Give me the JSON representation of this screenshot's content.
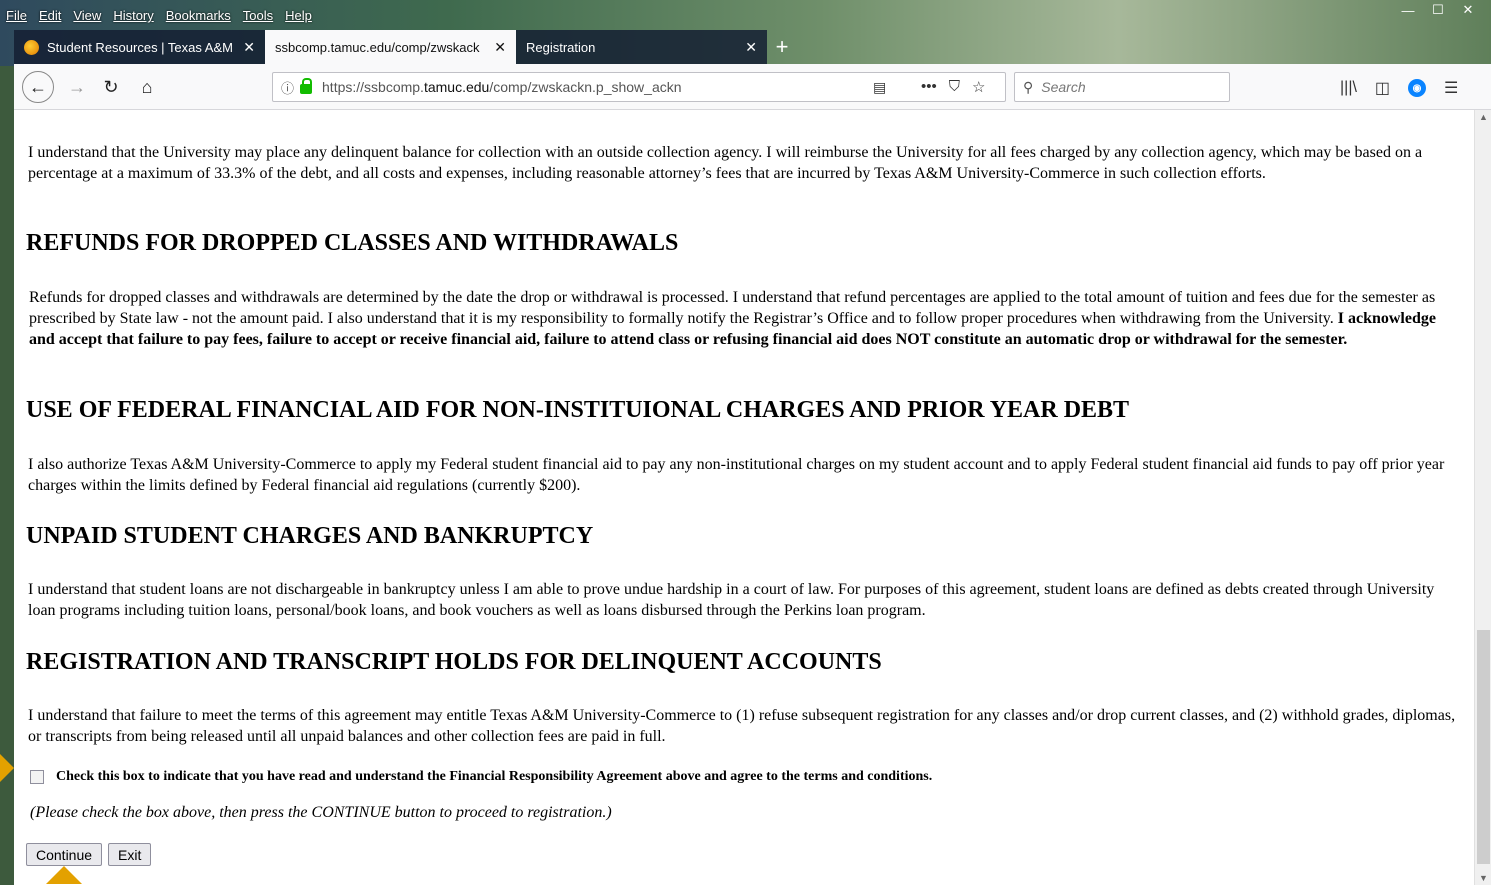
{
  "browser": {
    "menu": [
      "File",
      "Edit",
      "View",
      "History",
      "Bookmarks",
      "Tools",
      "Help"
    ],
    "window_controls": {
      "minimize": "—",
      "maximize": "☐",
      "close": "✕"
    },
    "tabs": [
      {
        "title": "Student Resources | Texas A&M",
        "close": "✕"
      },
      {
        "title": "ssbcomp.tamuc.edu/comp/zwskack",
        "close": "✕"
      },
      {
        "title": "Registration",
        "close": "✕"
      }
    ],
    "new_tab": "+",
    "nav": {
      "back": "←",
      "forward": "→",
      "reload": "↻",
      "home": "⌂"
    },
    "url": {
      "prefix": "https://ssbcomp.",
      "domain": "tamuc.edu",
      "path": "/comp/zwskackn.p_show_ackn"
    },
    "search_placeholder": "Search",
    "icons": {
      "info": "info-icon",
      "lock": "lock-icon",
      "reader": "reader-view-icon",
      "more": "more-icon",
      "pocket": "pocket-icon",
      "bookmark": "star-icon",
      "library": "library-icon",
      "sidebar": "sidebar-icon",
      "ublock": "ublock-icon",
      "menu": "hamburger-menu-icon"
    }
  },
  "page": {
    "collection_paragraph": "I understand that the University may place any delinquent balance for collection with an outside collection agency. I will reimburse the University for all fees charged by any collection agency, which may be based on a percentage at a maximum of 33.3% of the debt, and all costs and expenses, including reasonable attorney’s fees that are incurred by Texas A&M University-Commerce in such collection efforts.",
    "refunds_heading": "REFUNDS FOR DROPPED CLASSES AND WITHDRAWALS",
    "refunds_paragraph": "Refunds for dropped classes and withdrawals are determined by the date the drop or withdrawal is processed. I understand that refund percentages are applied to the total amount of tuition and fees due for the semester as prescribed by State law - not the amount paid. I also understand that it is my responsibility to formally notify the Registrar’s Office and to follow proper procedures when withdrawing from the University.",
    "refunds_bold": "I acknowledge and accept that failure to pay fees, failure to accept or receive financial aid, failure to attend class or refusing financial aid does NOT constitute an automatic drop or withdrawal for the semester.",
    "federal_heading": "USE OF FEDERAL FINANCIAL AID FOR NON-INSTITUIONAL CHARGES AND PRIOR YEAR DEBT",
    "federal_paragraph": "I also authorize Texas A&M University-Commerce to apply my Federal student financial aid to pay any non-institutional charges on my student account and to apply Federal student financial aid funds to pay off prior year charges within the limits defined by Federal financial aid regulations (currently $200).",
    "unpaid_heading": "UNPAID STUDENT CHARGES AND BANKRUPTCY",
    "unpaid_paragraph": "I understand that student loans are not dischargeable in bankruptcy unless I am able to prove undue hardship in a court of law. For purposes of this agreement, student loans are defined as debts created through University loan programs including tuition loans, personal/book loans, and book vouchers as well as loans disbursed through the Perkins loan program.",
    "holds_heading": "REGISTRATION AND TRANSCRIPT HOLDS FOR DELINQUENT ACCOUNTS",
    "holds_paragraph": "I understand that failure to meet the terms of this agreement may entitle Texas A&M University-Commerce to (1) refuse subsequent registration for any classes and/or drop current classes, and (2) withhold grades, diplomas, or transcripts from being released until all unpaid balances and other collection fees are paid in full.",
    "agree_label": "Check this box to indicate that you have read and understand the Financial Responsibility Agreement above and agree to the terms and conditions.",
    "agree_checked": false,
    "instruction": "(Please check the box above, then press the CONTINUE button to proceed to registration.)",
    "continue_label": "Continue",
    "exit_label": "Exit"
  },
  "colors": {
    "pointer": "#e3a100",
    "lock": "#12bc00"
  }
}
